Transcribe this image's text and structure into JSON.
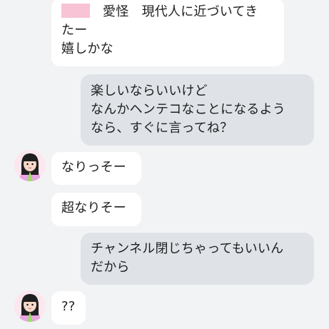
{
  "messages": [
    {
      "side": "in",
      "lines": [
        "愛怪　現代人に近づいてき",
        "たー",
        "嬉しかな"
      ]
    },
    {
      "side": "out",
      "lines": [
        "楽しいならいいけど",
        "なんかヘンテコなことになるよう",
        "なら、すぐに言ってね？"
      ]
    },
    {
      "side": "in",
      "lines": [
        "なりっそー"
      ]
    },
    {
      "side": "in",
      "lines": [
        "超なりそー"
      ]
    },
    {
      "side": "out",
      "lines": [
        "チャンネル閉じちゃってもいいん",
        "だから"
      ]
    },
    {
      "side": "in",
      "lines": [
        "??"
      ]
    }
  ],
  "colors": {
    "background": "#f2f3f5",
    "incoming_bubble": "#ffffff",
    "outgoing_bubble": "#dfe3e8",
    "redaction": "#f7c3d5"
  },
  "icons": {
    "avatar": "avatar-girl-icon"
  }
}
